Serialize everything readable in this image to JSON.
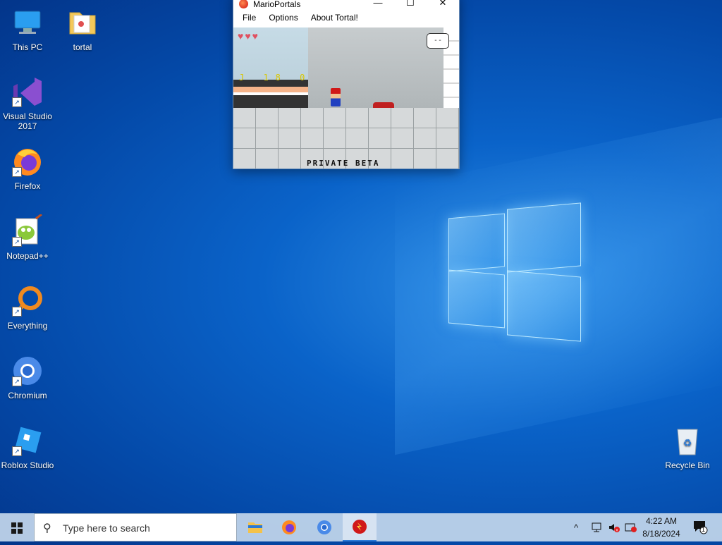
{
  "desktop": {
    "icons": [
      {
        "label": "This PC",
        "icon": "computer-icon"
      },
      {
        "label": "tortal",
        "icon": "folder-icon"
      },
      {
        "label": "Visual Studio 2017",
        "icon": "visual-studio-icon"
      },
      {
        "label": "Firefox",
        "icon": "firefox-icon"
      },
      {
        "label": "Notepad++",
        "icon": "notepad-plus-plus-icon"
      },
      {
        "label": "Everything",
        "icon": "everything-search-icon"
      },
      {
        "label": "Chromium",
        "icon": "chromium-icon"
      },
      {
        "label": "Roblox Studio",
        "icon": "roblox-studio-icon"
      },
      {
        "label": "Recycle Bin",
        "icon": "recycle-bin-icon"
      }
    ]
  },
  "window": {
    "title": "MarioPortals",
    "controls": {
      "minimize": "—",
      "maximize": "☐",
      "close": "✕"
    },
    "menu": [
      "File",
      "Options",
      "About Tortal!"
    ],
    "game": {
      "hearts": "♥♥♥",
      "counter": "J 18 0",
      "speech": "- -",
      "banner": "PRIVATE BETA"
    }
  },
  "taskbar": {
    "search_placeholder": "Type here to search",
    "apps": [
      {
        "name": "file-explorer-icon"
      },
      {
        "name": "firefox-icon"
      },
      {
        "name": "chromium-icon"
      },
      {
        "name": "marioportals-icon",
        "active": true
      }
    ],
    "tray": {
      "chevron": "^",
      "time": "4:22 AM",
      "date": "8/18/2024",
      "notification_count": "1"
    }
  },
  "colors": {
    "accent": "#2a7ad8",
    "desktop_bg": "#0a63c9"
  }
}
